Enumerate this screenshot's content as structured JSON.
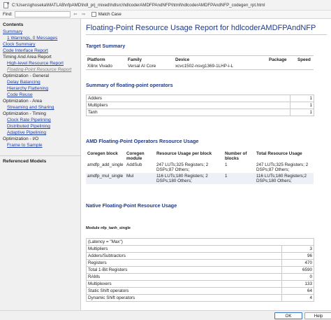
{
  "window": {
    "title": "C:\\Users\\ghoseka\\MATLAB\\nfpAMD\\hdl_prj_mixed\\hdlsrc\\hdlcoderAMDFPAndNFP\\html\\hdlcoderAMDFPAndNFP_codegen_rpt.html"
  },
  "toolbar": {
    "find_label": "Find:",
    "find_value": "",
    "prev_glyph": "⇦",
    "next_glyph": "⇨",
    "match_case_label": "Match Case"
  },
  "sidebar": {
    "contents_title": "Contents",
    "items": [
      {
        "label": "Summary",
        "kind": "link"
      },
      {
        "label": "1 Warnings, 0 Messages",
        "kind": "link-sub"
      },
      {
        "label": "Clock Summary",
        "kind": "link"
      },
      {
        "label": "Code Interface Report",
        "kind": "link"
      },
      {
        "label": "Timing And Area Report",
        "kind": "cat"
      },
      {
        "label": "High-level Resource Report",
        "kind": "link-sub"
      },
      {
        "label": "Floating-Point Resource Report",
        "kind": "sel"
      },
      {
        "label": "Optimization - General",
        "kind": "cat"
      },
      {
        "label": "Delay Balancing",
        "kind": "link-sub"
      },
      {
        "label": "Hierarchy Flattening",
        "kind": "link-sub"
      },
      {
        "label": "Code Reuse",
        "kind": "link-sub"
      },
      {
        "label": "Optimization - Area",
        "kind": "cat"
      },
      {
        "label": "Streaming and Sharing",
        "kind": "link-sub"
      },
      {
        "label": "Optimization - Timing",
        "kind": "cat"
      },
      {
        "label": "Clock Rate Pipelining",
        "kind": "link-sub"
      },
      {
        "label": "Distributed Pipelining",
        "kind": "link-sub"
      },
      {
        "label": "Adaptive Pipelining",
        "kind": "link-sub"
      },
      {
        "label": "Optimization - I/O",
        "kind": "cat"
      },
      {
        "label": "Frame to Sample",
        "kind": "link-sub"
      }
    ],
    "referenced_models": "Referenced Models"
  },
  "report": {
    "title": "Floating-Point Resource Usage Report for hdlcoderAMDFPAndNFP",
    "target_summary": {
      "heading": "Target Summary",
      "headers": [
        "Platform",
        "Family",
        "Device",
        "Package",
        "Speed"
      ],
      "row": [
        "Xilinx Vivado",
        "Versal AI Core",
        "xcvc1502-nsvg1369-1LHP-i-L",
        "",
        ""
      ]
    },
    "fp_summary": {
      "heading": "Summary of floating-point operators",
      "rows": [
        {
          "name": "Adders",
          "count": "1"
        },
        {
          "name": "Multipliers",
          "count": "1"
        },
        {
          "name": "Tanh",
          "count": "1"
        }
      ]
    },
    "amd_fp": {
      "heading": "AMD Floating-Point Operators Resource Usage",
      "headers": [
        "Coregen block",
        "Coregen module",
        "Resource Usage per block",
        "Number of blocks",
        "Total Resource Usage"
      ],
      "rows": [
        [
          "amdfp_add_single",
          "AddSub",
          "247 LUTs;325 Registers; 2 DSPs;87 Others;",
          "1",
          "247 LUTs;325 Registers; 2 DSPs;87 Others;"
        ],
        [
          "amdfp_mul_single",
          "Mul",
          "116 LUTs;180 Registers; 2 DSPs;180 Others;",
          "1",
          "116 LUTs;180 Registers;2 DSPs;180 Others;"
        ]
      ]
    },
    "native_fp": {
      "heading": "Native Floating-Point Resource Usage",
      "module_label": "Module nfp_tanh_single",
      "latency": "(Latency = \"Max\")",
      "rows": [
        {
          "name": "Multipliers",
          "count": "3"
        },
        {
          "name": "Adders/Subtractors",
          "count": "96"
        },
        {
          "name": "Registers",
          "count": "470"
        },
        {
          "name": "Total 1-Bit Registers",
          "count": "6590"
        },
        {
          "name": "RAMs",
          "count": "0"
        },
        {
          "name": "Multiplexers",
          "count": "133"
        },
        {
          "name": "Static Shift operators",
          "count": "64"
        },
        {
          "name": "Dynamic Shift operators",
          "count": "4"
        }
      ]
    }
  },
  "buttons": {
    "ok": "OK",
    "help": "Help"
  }
}
